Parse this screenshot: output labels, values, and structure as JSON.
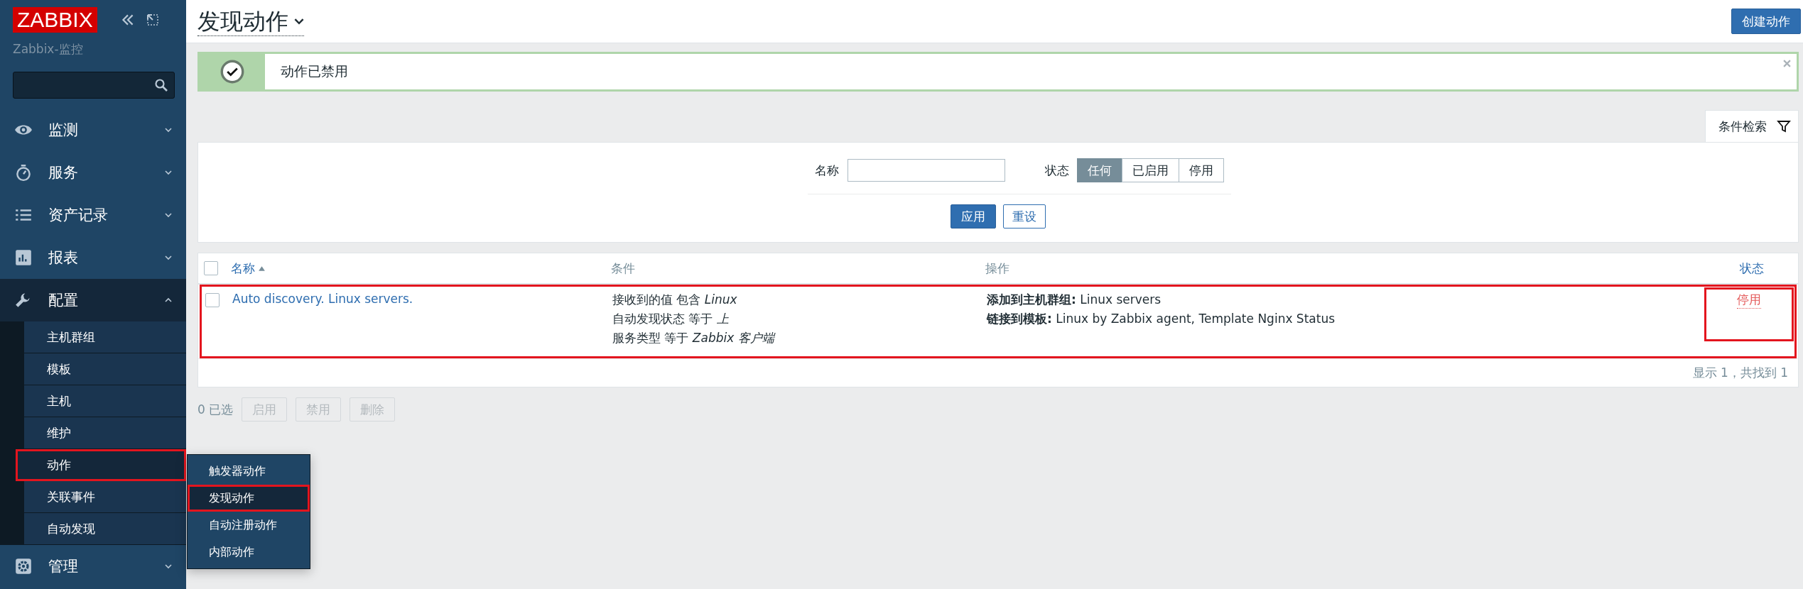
{
  "sidebar": {
    "logo": "ZABBIX",
    "subtitle": "Zabbix-监控",
    "nav": [
      {
        "label": "监测",
        "expanded": false
      },
      {
        "label": "服务",
        "expanded": false
      },
      {
        "label": "资产记录",
        "expanded": false
      },
      {
        "label": "报表",
        "expanded": false
      },
      {
        "label": "配置",
        "expanded": true,
        "children": [
          {
            "label": "主机群组",
            "selected": false,
            "marked": false
          },
          {
            "label": "模板",
            "selected": false,
            "marked": false
          },
          {
            "label": "主机",
            "selected": false,
            "marked": false
          },
          {
            "label": "维护",
            "selected": false,
            "marked": false
          },
          {
            "label": "动作",
            "selected": true,
            "marked": true
          },
          {
            "label": "关联事件",
            "selected": false,
            "marked": false
          },
          {
            "label": "自动发现",
            "selected": false,
            "marked": false
          }
        ]
      },
      {
        "label": "管理",
        "expanded": false
      }
    ]
  },
  "popup_menu": [
    {
      "label": "触发器动作",
      "selected": false,
      "marked": false
    },
    {
      "label": "发现动作",
      "selected": true,
      "marked": true
    },
    {
      "label": "自动注册动作",
      "selected": false,
      "marked": false
    },
    {
      "label": "内部动作",
      "selected": false,
      "marked": false
    }
  ],
  "header": {
    "title": "发现动作",
    "create_button": "创建动作"
  },
  "message": {
    "text": "动作已禁用"
  },
  "filter": {
    "tab": "条件检索",
    "name_label": "名称",
    "status_label": "状态",
    "status_options": [
      {
        "label": "任何",
        "selected": true
      },
      {
        "label": "已启用",
        "selected": false
      },
      {
        "label": "停用",
        "selected": false
      }
    ],
    "apply": "应用",
    "reset": "重设"
  },
  "table": {
    "select_all_checked": false,
    "columns": [
      {
        "label": "名称",
        "sorted": true
      },
      {
        "label": "条件",
        "sorted": false
      },
      {
        "label": "操作",
        "sorted": false
      },
      {
        "label": "状态",
        "sorted": false
      }
    ],
    "rows": [
      {
        "checked": false,
        "marked": true,
        "name": "Auto discovery. Linux servers.",
        "conditions": [
          "接收到的值 包含 *Linux*",
          "自动发现状态 等于 *上*",
          "服务类型 等于 *Zabbix 客户端*"
        ],
        "operations": [
          "**添加到主机群组:** Linux servers",
          "**链接到模板:** Linux by Zabbix agent, Template Nginx Status"
        ],
        "status": "停用",
        "enabled": false,
        "status_marked": true
      }
    ],
    "footer": "显示 1，共找到 1"
  },
  "selection": {
    "count": "0 已选",
    "buttons": [
      {
        "label": "启用",
        "disabled": true
      },
      {
        "label": "禁用",
        "disabled": true
      },
      {
        "label": "删除",
        "disabled": true
      }
    ]
  }
}
